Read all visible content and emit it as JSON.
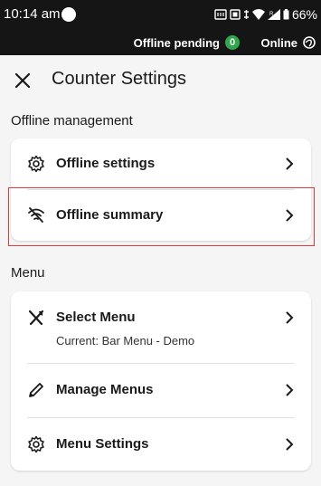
{
  "status_bar": {
    "time": "10:14 am",
    "battery": "66%",
    "icons": [
      "nfc-icon",
      "cast-icon",
      "vibrate-icon",
      "wifi-icon",
      "signal-icon",
      "battery-icon"
    ]
  },
  "sync_bar": {
    "pending_label": "Offline pending",
    "pending_count": "0",
    "status_label": "Online"
  },
  "header": {
    "title": "Counter Settings"
  },
  "sections": {
    "offline": {
      "title": "Offline management",
      "items": [
        {
          "label": "Offline settings",
          "icon": "gear-icon"
        },
        {
          "label": "Offline summary",
          "icon": "wifi-off-icon"
        }
      ]
    },
    "menu": {
      "title": "Menu",
      "items": [
        {
          "label": "Select Menu",
          "sub": "Current: Bar Menu - Demo",
          "icon": "utensils-icon"
        },
        {
          "label": "Manage Menus",
          "icon": "pencil-icon"
        },
        {
          "label": "Menu Settings",
          "icon": "gear-icon"
        }
      ]
    }
  },
  "colors": {
    "status_bg": "#151515",
    "badge_green": "#2ea84a",
    "highlight": "#e53935",
    "page_bg": "#f5f5f5"
  }
}
